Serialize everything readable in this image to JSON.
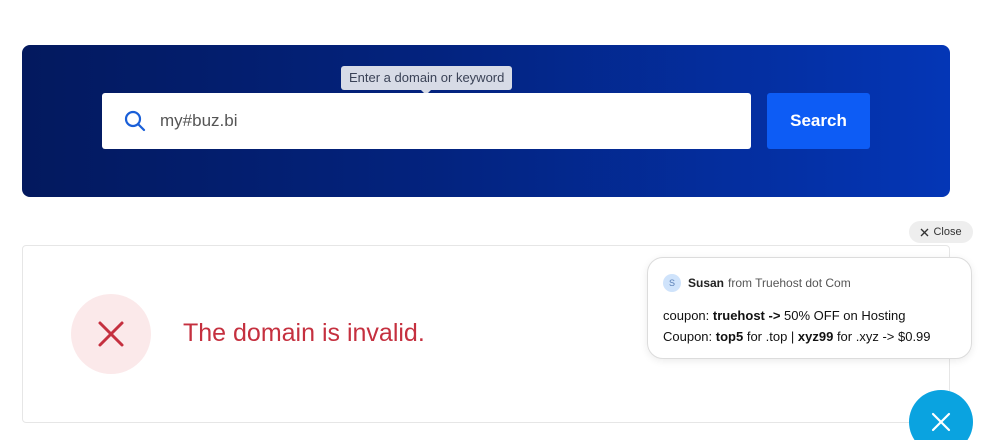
{
  "search": {
    "tooltip": "Enter a domain or keyword",
    "value": "my#buz.bi",
    "button_label": "Search"
  },
  "result": {
    "message": "The domain is invalid."
  },
  "chat": {
    "close_label": "Close",
    "sender_name": "Susan",
    "sender_org": "from Truehost dot Com",
    "avatar_initial": "S",
    "line1_prefix": "coupon: ",
    "line1_code": "truehost ->",
    "line1_suffix": " 50% OFF on Hosting",
    "line2_prefix": "Coupon: ",
    "line2_code1": "top5",
    "line2_mid": " for  .top | ",
    "line2_code2": "xyz99",
    "line2_suffix": " for .xyz -> $0.99"
  },
  "colors": {
    "hero_start": "#03195e",
    "hero_end": "#0436b6",
    "button": "#0d5cf5",
    "error": "#c5303f",
    "fab": "#0aa3e0"
  }
}
